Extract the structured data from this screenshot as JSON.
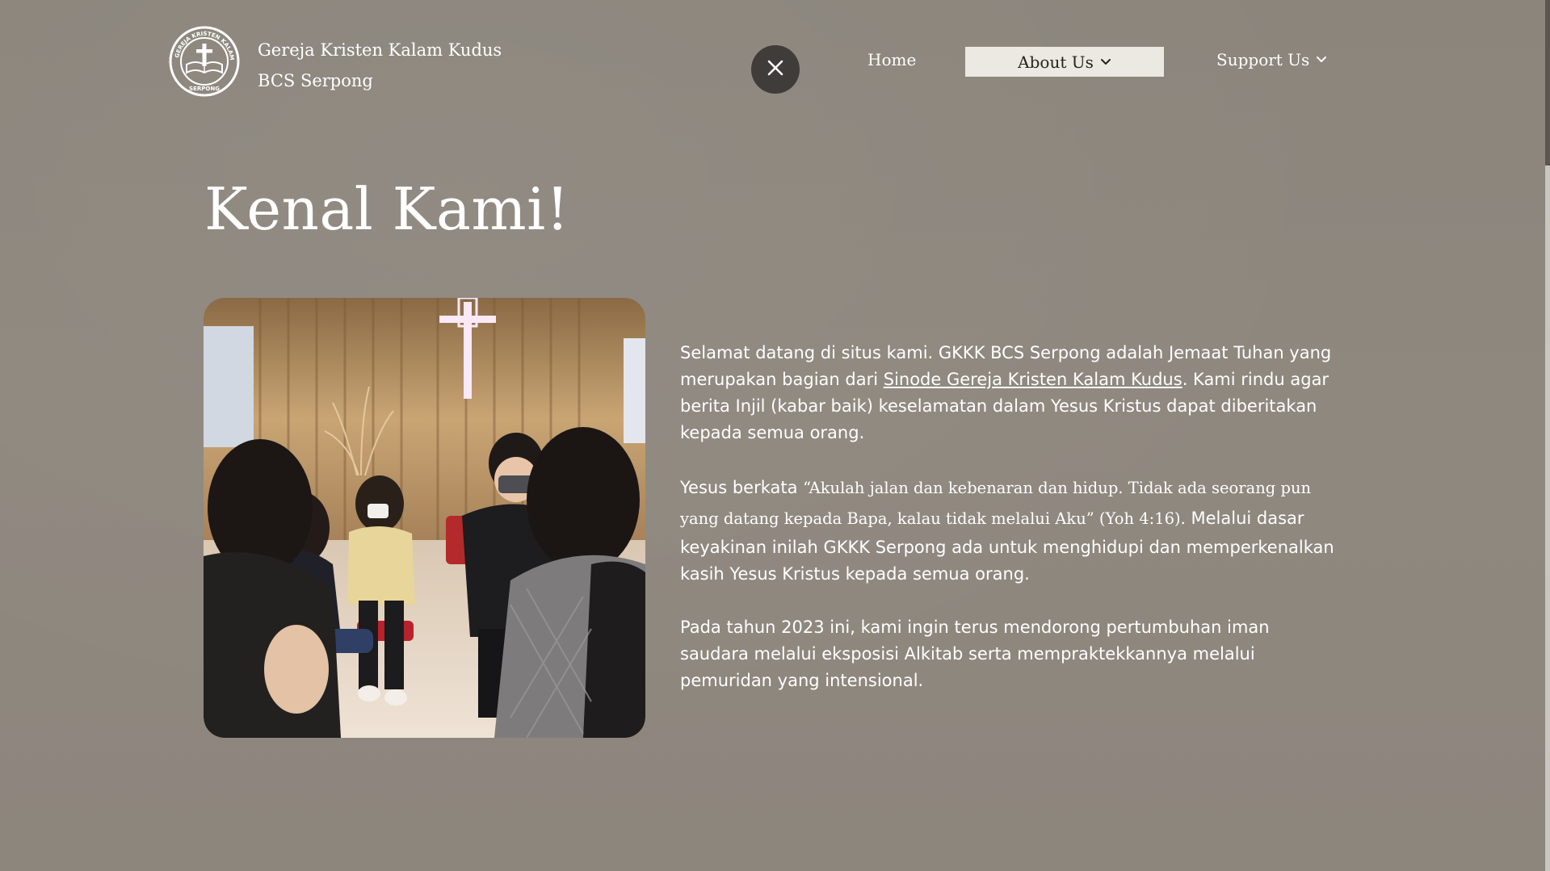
{
  "header": {
    "site_name_line1": "Gereja Kristen Kalam Kudus",
    "site_name_line2": "BCS Serpong",
    "logo_text_top": "GEREJA KRISTEN KALAM KUDUS",
    "logo_text_bottom": "SERPONG",
    "logo_text_center": "KALAM KUDUS",
    "close_icon": "close-icon"
  },
  "nav": {
    "home": "Home",
    "about": "About Us",
    "support": "Support Us",
    "dropdown_icon": "chevron-down-icon"
  },
  "main": {
    "title": "Kenal Kami!",
    "p1_before_link": "Selamat datang di situs kami. GKKK BCS Serpong adalah Jemaat Tuhan yang merupakan bagian dari ",
    "p1_link": "Sinode Gereja Kristen Kalam Kudus",
    "p1_after_link": ". Kami rindu agar berita Injil (kabar baik) keselamatan dalam Yesus Kristus dapat diberitakan kepada semua orang.",
    "p2_before_quote": "Yesus berkata ",
    "p2_quote": "“Akulah jalan dan kebenaran dan hidup. Tidak ada seorang pun yang datang kepada Bapa, kalau tidak melalui Aku” (Yoh 4:16).",
    "p2_after_quote": " Melalui dasar keyakinan inilah GKKK Serpong ada untuk menghidupi dan memperkenalkan kasih Yesus Kristus kepada semua orang.",
    "p3": "Pada tahun 2023 ini, kami ingin terus mendorong pertumbuhan iman saudara melalui eksposisi Alkitab serta mempraktekkannya melalui pemuridan yang intensional."
  },
  "colors": {
    "background": "#8e877e",
    "nav_active_bg": "#ece8e2",
    "close_button_bg": "#3f3c39"
  }
}
